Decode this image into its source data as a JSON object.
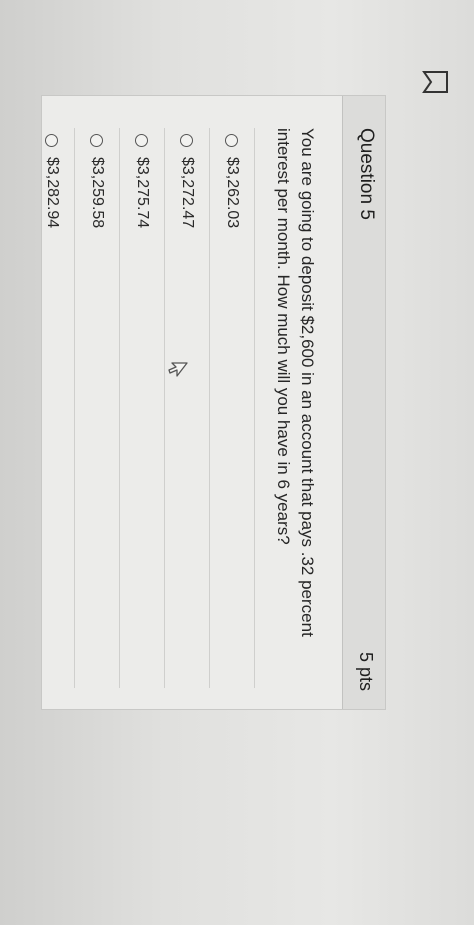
{
  "question": {
    "title": "Question 5",
    "points": "5 pts",
    "text": "You are going to deposit $2,600 in an account that pays .32 percent interest per month. How much will you have in 6 years?"
  },
  "answers": [
    {
      "label": "$3,262.03"
    },
    {
      "label": "$3,272.47"
    },
    {
      "label": "$3,275.74"
    },
    {
      "label": "$3,259.58"
    },
    {
      "label": "$3,282.94"
    }
  ],
  "icons": {
    "flag": "bookmark-flag-icon",
    "cursor": "mouse-pointer-icon"
  }
}
